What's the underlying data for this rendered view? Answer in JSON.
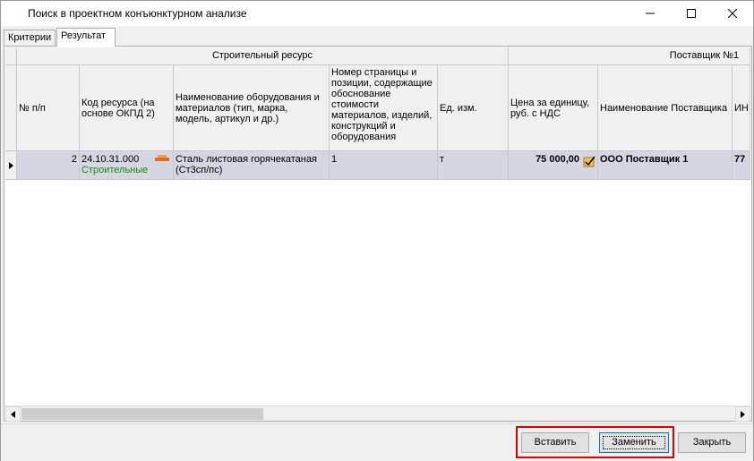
{
  "window": {
    "title": "Поиск в проектном конъюнктурном анализе"
  },
  "tabs": [
    {
      "label": "Критерии",
      "active": false
    },
    {
      "label": "Результат",
      "active": true
    }
  ],
  "table": {
    "group_headers": {
      "resource": "Строительный ресурс",
      "supplier": "Поставщик №1"
    },
    "columns": {
      "num": "№ п/п",
      "code": "Код ресурса (на основе ОКПД 2)",
      "name": "Наименование оборудования и материалов (тип, марка, модель, артикул и др.)",
      "page": "Номер страницы и позиции, содержащие обоснование стоимости материалов, изделий, конструкций и оборудования",
      "unit": "Ед. изм.",
      "price": "Цена за единицу, руб. с НДС",
      "supplier_name": "Наименование Поставщика",
      "inn": "ИН"
    },
    "rows": [
      {
        "num": "2",
        "code": "24.10.31.000",
        "category": "Строительные",
        "name": "Сталь листовая горячекатаная (Ст3сп/пс)",
        "page": "1",
        "unit": "т",
        "price": "75 000,00",
        "supplier_name": "ООО Поставщик 1",
        "inn": "77"
      }
    ]
  },
  "buttons": {
    "insert": "Вставить",
    "replace": "Заменить",
    "close": "Закрыть"
  },
  "colors": {
    "selected_row": "#d4d6e2",
    "category_text": "#1a8a1a",
    "highlight_border": "#e00000"
  }
}
